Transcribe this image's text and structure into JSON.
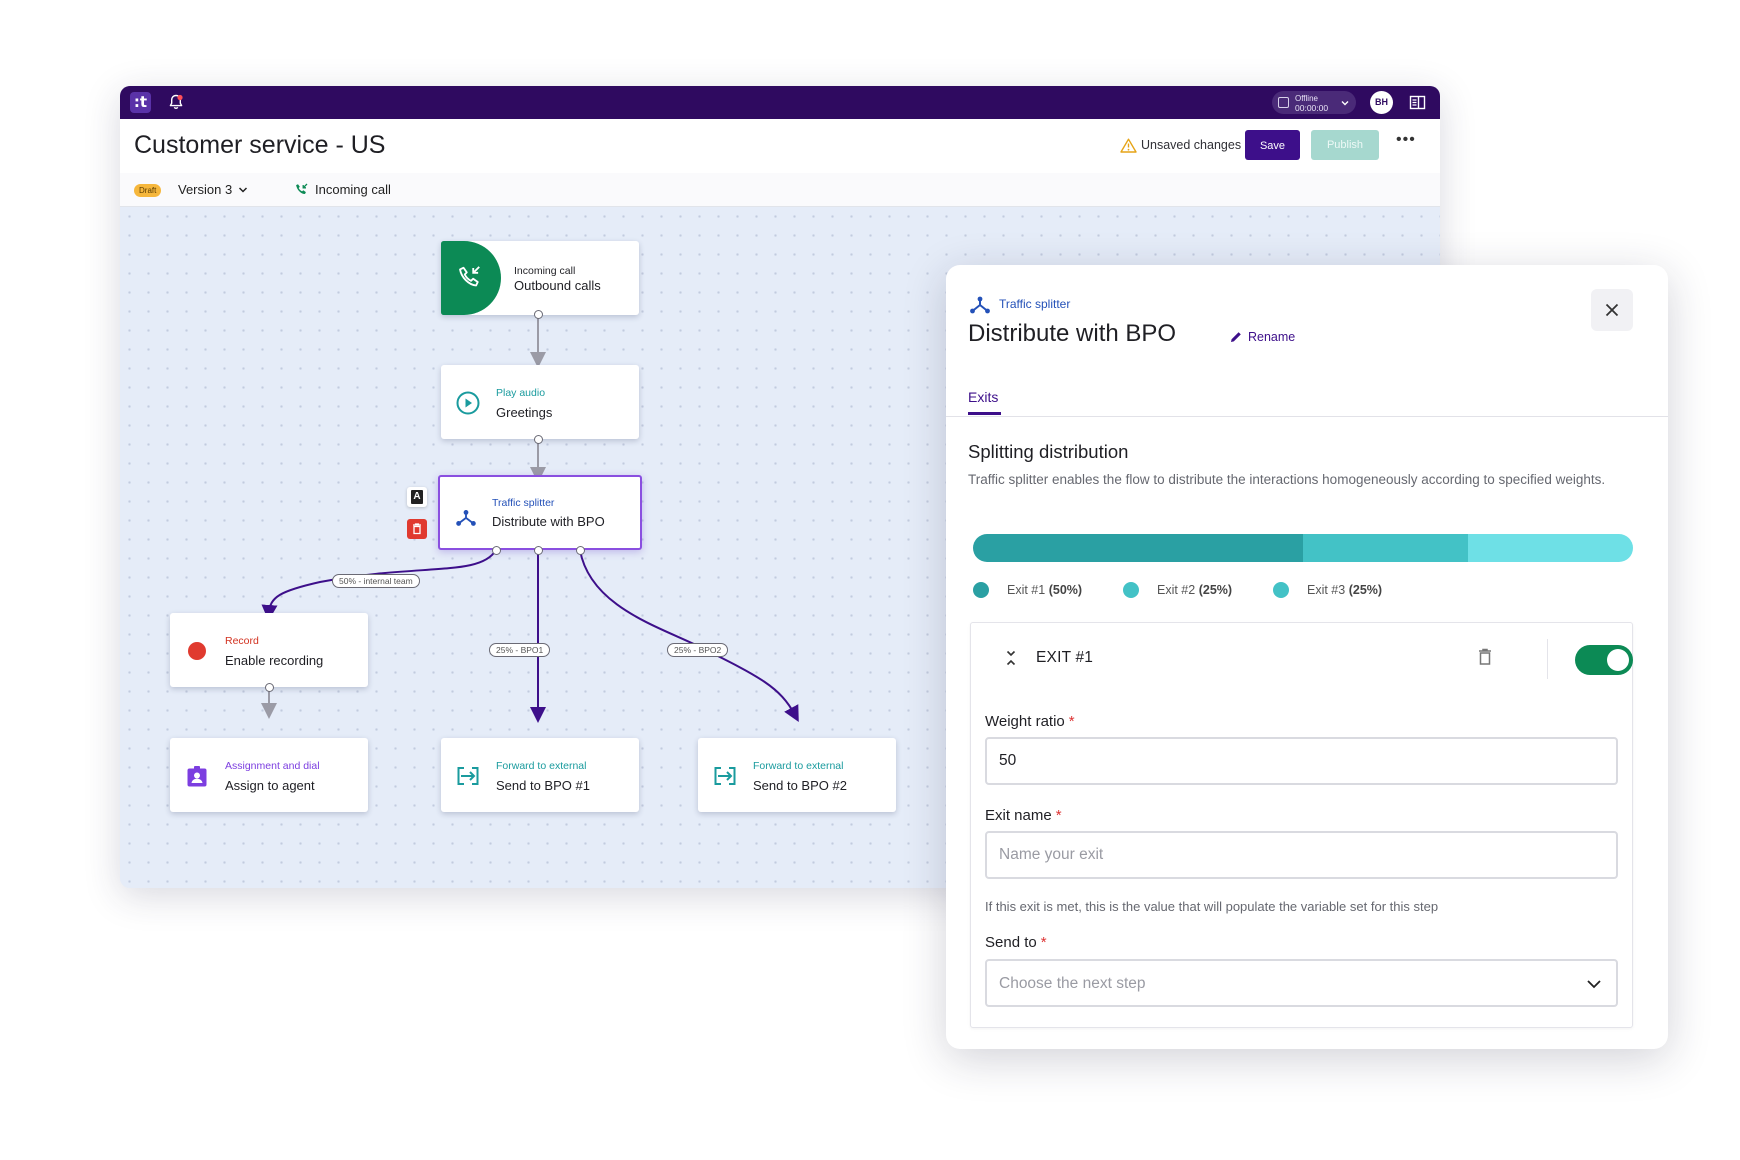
{
  "app": {
    "title": "Customer service - US",
    "status": {
      "line1": "Offline",
      "line2": "00:00:00"
    },
    "user_initials": "BH",
    "unsaved_text": "Unsaved changes",
    "save_label": "Save",
    "publish_label": "Publish",
    "more_label": "•••",
    "draft_badge": "Draft",
    "version_label": "Version 3",
    "trigger_label": "Incoming call"
  },
  "colors": {
    "topbar": "#2f0a60",
    "primary": "#3d0f8a",
    "green": "#0c8a55",
    "split_exit1": "#2aa0a3",
    "split_exit2": "#43c2c6",
    "split_exit3": "#6ee0e6"
  },
  "flow": {
    "nodes": [
      {
        "id": "incoming",
        "type": "Incoming call",
        "label": "Outbound calls",
        "icon": "phone-incoming-icon"
      },
      {
        "id": "play",
        "type": "Play audio",
        "label": "Greetings",
        "icon": "play-circle-icon"
      },
      {
        "id": "splitter",
        "type": "Traffic splitter",
        "label": "Distribute with BPO",
        "icon": "splitter-icon"
      },
      {
        "id": "record",
        "type": "Record",
        "label": "Enable recording",
        "icon": "record-dot-icon"
      },
      {
        "id": "assign",
        "type": "Assignment and dial",
        "label": "Assign to agent",
        "icon": "agent-badge-icon"
      },
      {
        "id": "bpo1",
        "type": "Forward to external",
        "label": "Send to BPO #1",
        "icon": "forward-icon"
      },
      {
        "id": "bpo2",
        "type": "Forward to external",
        "label": "Send to BPO #2",
        "icon": "forward-icon"
      }
    ],
    "edge_labels": [
      "50% - internal team",
      "25% - BPO1",
      "25% - BPO2"
    ],
    "mini_buttons": {
      "rename": "A"
    }
  },
  "panel": {
    "type": "Traffic splitter",
    "title": "Distribute with BPO",
    "rename_label": "Rename",
    "tab_label": "Exits",
    "section_title": "Splitting distribution",
    "section_desc": "Traffic splitter enables the flow to distribute the interactions homogeneously according to specified weights.",
    "distribution": [
      {
        "name": "Exit #1",
        "pct": "(50%)",
        "weight": 50
      },
      {
        "name": "Exit #2",
        "pct": "(25%)",
        "weight": 25
      },
      {
        "name": "Exit #3",
        "pct": "(25%)",
        "weight": 25
      }
    ],
    "exit_card": {
      "title": "EXIT #1",
      "enabled": true,
      "weight_label": "Weight ratio",
      "weight_value": "50",
      "name_label": "Exit name",
      "name_placeholder": "Name your exit",
      "name_help": "If this exit is met, this is the value that will populate the variable set for this step",
      "send_label": "Send to",
      "send_placeholder": "Choose the next step",
      "required_mark": "*"
    }
  }
}
